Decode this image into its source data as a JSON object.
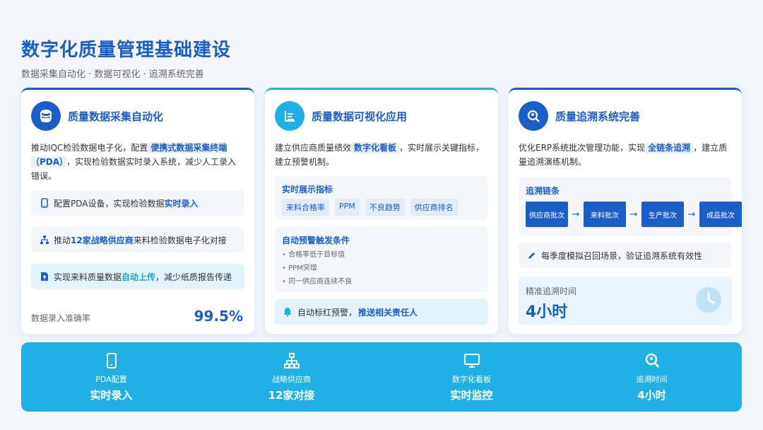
{
  "header": {
    "title": "数字化质量管理基础建设",
    "subtitle": "数据采集自动化 · 数据可视化 · 追溯系统完善"
  },
  "card1": {
    "title": "质量数据采集自动化",
    "icon": "database-icon",
    "desc_pre": "推动IQC检验数据电子化，配置",
    "desc_hl": "便携式数据采集终端（PDA）",
    "desc_post": "，实现检验数据实时录入系统，减少人工录入错误。",
    "features": [
      {
        "pre": "配置PDA设备，实现检验数据",
        "bold": "实时录入",
        "post": ""
      },
      {
        "pre": "推动",
        "bold": "12家战略供应商",
        "post": "来料检验数据电子化对接"
      },
      {
        "pre": "实现来料质量数据",
        "bold": "自动上传",
        "post": "，减少纸质报告传递"
      }
    ],
    "stat_label": "数据录入准确率",
    "stat_value": "99.5%"
  },
  "card2": {
    "title": "质量数据可视化应用",
    "icon": "chart-list-icon",
    "desc_pre": "建立供应商质量绩效",
    "desc_hl": "数字化看板",
    "desc_post": "，实时展示关键指标，建立预警机制。",
    "metrics_title": "实时展示指标",
    "metrics": [
      "来料合格率",
      "PPM",
      "不良趋势",
      "供应商排名"
    ],
    "triggers_title": "自动预警触发条件",
    "triggers": [
      "合格率低于目标值",
      "PPM突增",
      "同一供应商连续不良"
    ],
    "alert_pre": "自动标红预警，",
    "alert_bold": "推送相关责任人"
  },
  "card3": {
    "title": "质量追溯系统完善",
    "icon": "search-location-icon",
    "desc_pre": "优化ERP系统批次管理功能，实现",
    "desc_hl": "全链条追溯",
    "desc_post": "，建立质量追溯演练机制。",
    "chain_title": "追溯链条",
    "chain": [
      "供应商批次",
      "来料批次",
      "生产批次",
      "成品批次"
    ],
    "drill_text": "每季度模拟召回场景，验证追溯系统有效性",
    "time_label": "精准追溯时间",
    "time_value": "4小时"
  },
  "banner": [
    {
      "label": "PDA配置",
      "value": "实时录入",
      "icon": "tablet-icon"
    },
    {
      "label": "战略供应商",
      "value": "12家对接",
      "icon": "network-icon"
    },
    {
      "label": "数字化看板",
      "value": "实时监控",
      "icon": "monitor-icon"
    },
    {
      "label": "追溯时间",
      "value": "4小时",
      "icon": "location-search-icon"
    }
  ],
  "colors": {
    "primary": "#1a5fc8",
    "cyan": "#1fb1e6",
    "background": "#f3f7fc"
  }
}
